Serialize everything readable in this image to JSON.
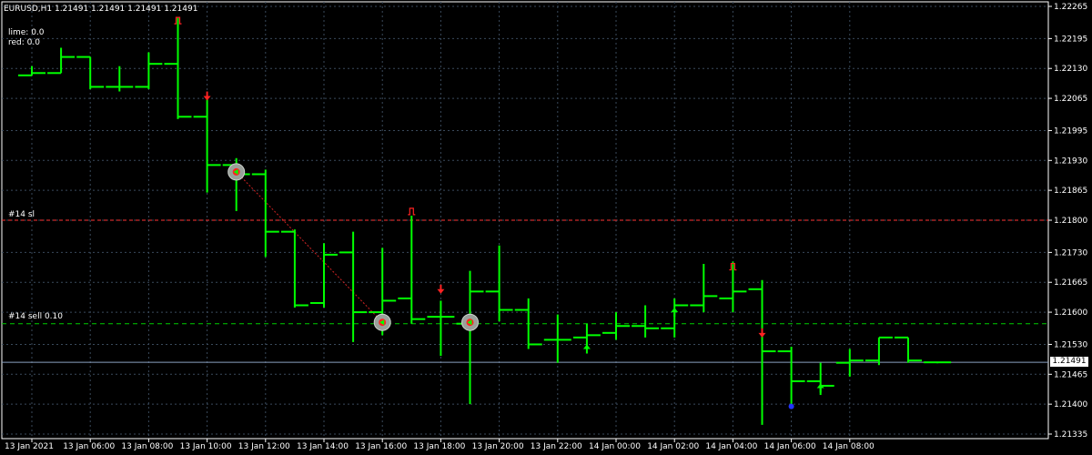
{
  "header": {
    "symbol_text": "EURUSD,H1  1.21491 1.21491 1.21491 1.21491",
    "indicator_lime": "lime: 0.0",
    "indicator_red": "red: 0.0"
  },
  "order_lines": {
    "stop_loss": {
      "label": "#14 sl",
      "price": 1.218,
      "color": "#ff3333"
    },
    "entry": {
      "label": "#14 sell 0.10",
      "price": 1.21575,
      "color": "#00cc00"
    }
  },
  "current_price": {
    "value": 1.21491,
    "label": "1.21491"
  },
  "colors": {
    "background": "#000000",
    "grid": "#3a4a5c",
    "bars": "#00ff00",
    "buy_arrow": "#00ff00",
    "sell_arrow": "#ff2222",
    "price_line": "#8aa0c0"
  },
  "chart_data": {
    "type": "ohlc",
    "symbol": "EURUSD",
    "timeframe": "H1",
    "ylim": [
      1.21335,
      1.22265
    ],
    "y_ticks": [
      "1.22265",
      "1.22195",
      "1.22130",
      "1.22065",
      "1.21995",
      "1.21930",
      "1.21865",
      "1.21800",
      "1.21730",
      "1.21665",
      "1.21600",
      "1.21530",
      "1.21465",
      "1.21400",
      "1.21335"
    ],
    "x_ticks": [
      {
        "bar": 0,
        "label": "13 Jan 2021"
      },
      {
        "bar": 2,
        "label": "13 Jan 06:00"
      },
      {
        "bar": 4,
        "label": "13 Jan 08:00"
      },
      {
        "bar": 6,
        "label": "13 Jan 10:00"
      },
      {
        "bar": 8,
        "label": "13 Jan 12:00"
      },
      {
        "bar": 10,
        "label": "13 Jan 14:00"
      },
      {
        "bar": 12,
        "label": "13 Jan 16:00"
      },
      {
        "bar": 14,
        "label": "13 Jan 18:00"
      },
      {
        "bar": 16,
        "label": "13 Jan 20:00"
      },
      {
        "bar": 18,
        "label": "13 Jan 22:00"
      },
      {
        "bar": 20,
        "label": "14 Jan 00:00"
      },
      {
        "bar": 22,
        "label": "14 Jan 02:00"
      },
      {
        "bar": 24,
        "label": "14 Jan 04:00"
      },
      {
        "bar": 26,
        "label": "14 Jan 06:00"
      },
      {
        "bar": 28,
        "label": "14 Jan 08:00"
      }
    ],
    "ohlc": [
      {
        "o": 1.22115,
        "h": 1.22135,
        "l": 1.22115,
        "c": 1.2212
      },
      {
        "o": 1.2212,
        "h": 1.22175,
        "l": 1.2212,
        "c": 1.22155
      },
      {
        "o": 1.22155,
        "h": 1.22155,
        "l": 1.22085,
        "c": 1.2209
      },
      {
        "o": 1.2209,
        "h": 1.22135,
        "l": 1.2208,
        "c": 1.2209
      },
      {
        "o": 1.2209,
        "h": 1.22165,
        "l": 1.22085,
        "c": 1.2214
      },
      {
        "o": 1.2214,
        "h": 1.2224,
        "l": 1.2202,
        "c": 1.22025
      },
      {
        "o": 1.22025,
        "h": 1.2207,
        "l": 1.2186,
        "c": 1.2192
      },
      {
        "o": 1.2192,
        "h": 1.21935,
        "l": 1.2182,
        "c": 1.219
      },
      {
        "o": 1.219,
        "h": 1.2191,
        "l": 1.2172,
        "c": 1.21775
      },
      {
        "o": 1.21775,
        "h": 1.2178,
        "l": 1.2161,
        "c": 1.21615
      },
      {
        "o": 1.2162,
        "h": 1.2175,
        "l": 1.2161,
        "c": 1.21725
      },
      {
        "o": 1.2173,
        "h": 1.21775,
        "l": 1.21535,
        "c": 1.216
      },
      {
        "o": 1.216,
        "h": 1.2174,
        "l": 1.2155,
        "c": 1.21625
      },
      {
        "o": 1.2163,
        "h": 1.2181,
        "l": 1.21575,
        "c": 1.21585
      },
      {
        "o": 1.2159,
        "h": 1.21625,
        "l": 1.21505,
        "c": 1.2159
      },
      {
        "o": 1.21575,
        "h": 1.2169,
        "l": 1.214,
        "c": 1.21645
      },
      {
        "o": 1.21645,
        "h": 1.21745,
        "l": 1.2158,
        "c": 1.21605
      },
      {
        "o": 1.21605,
        "h": 1.2163,
        "l": 1.2152,
        "c": 1.2153
      },
      {
        "o": 1.2154,
        "h": 1.21595,
        "l": 1.2149,
        "c": 1.2154
      },
      {
        "o": 1.21545,
        "h": 1.21575,
        "l": 1.2152,
        "c": 1.2155
      },
      {
        "o": 1.21555,
        "h": 1.216,
        "l": 1.2154,
        "c": 1.2157
      },
      {
        "o": 1.2157,
        "h": 1.21615,
        "l": 1.21545,
        "c": 1.21565
      },
      {
        "o": 1.21565,
        "h": 1.2163,
        "l": 1.21545,
        "c": 1.21615
      },
      {
        "o": 1.21615,
        "h": 1.21705,
        "l": 1.216,
        "c": 1.21635
      },
      {
        "o": 1.2163,
        "h": 1.2171,
        "l": 1.216,
        "c": 1.21645
      },
      {
        "o": 1.2165,
        "h": 1.2167,
        "l": 1.21355,
        "c": 1.21515
      },
      {
        "o": 1.21515,
        "h": 1.21525,
        "l": 1.2139,
        "c": 1.2145
      },
      {
        "o": 1.2145,
        "h": 1.2149,
        "l": 1.2142,
        "c": 1.2144
      },
      {
        "o": 1.2149,
        "h": 1.2152,
        "l": 1.2146,
        "c": 1.21495
      },
      {
        "o": 1.21495,
        "h": 1.21545,
        "l": 1.21485,
        "c": 1.21545
      },
      {
        "o": 1.21545,
        "h": 1.21545,
        "l": 1.2149,
        "c": 1.21495
      },
      {
        "o": 1.21491,
        "h": 1.21491,
        "l": 1.21491,
        "c": 1.21491
      }
    ],
    "markers": [
      {
        "type": "sell-stop-symbol",
        "bar": 5,
        "price": 1.22235,
        "color": "#ff2222"
      },
      {
        "type": "sell-arrow",
        "bar": 6,
        "price": 1.2207,
        "color": "#ff2222"
      },
      {
        "type": "order-circle",
        "bar": 7,
        "price": 1.21905
      },
      {
        "type": "sell-stop-symbol",
        "bar": 13,
        "price": 1.2182,
        "color": "#ff2222"
      },
      {
        "type": "order-circle",
        "bar": 12,
        "price": 1.21578
      },
      {
        "type": "sell-arrow",
        "bar": 14,
        "price": 1.2165,
        "color": "#ff2222"
      },
      {
        "type": "order-circle",
        "bar": 15,
        "price": 1.21578
      },
      {
        "type": "buy-arrow",
        "bar": 19,
        "price": 1.2152,
        "color": "#00ff00"
      },
      {
        "type": "buy-arrow",
        "bar": 22,
        "price": 1.216,
        "color": "#00ff00"
      },
      {
        "type": "sell-stop-symbol",
        "bar": 24,
        "price": 1.217,
        "color": "#ff2222"
      },
      {
        "type": "sell-arrow",
        "bar": 25,
        "price": 1.21555,
        "color": "#ff2222"
      },
      {
        "type": "blue-dot",
        "bar": 26,
        "price": 1.21395,
        "color": "#2233ff"
      },
      {
        "type": "buy-arrow",
        "bar": 27,
        "price": 1.21435,
        "color": "#00ff00"
      }
    ],
    "trade_lines": [
      {
        "from_bar": 7,
        "from_price": 1.21905,
        "to_bar": 12,
        "to_price": 1.21578,
        "color": "#cc2222"
      }
    ],
    "grid": true
  }
}
